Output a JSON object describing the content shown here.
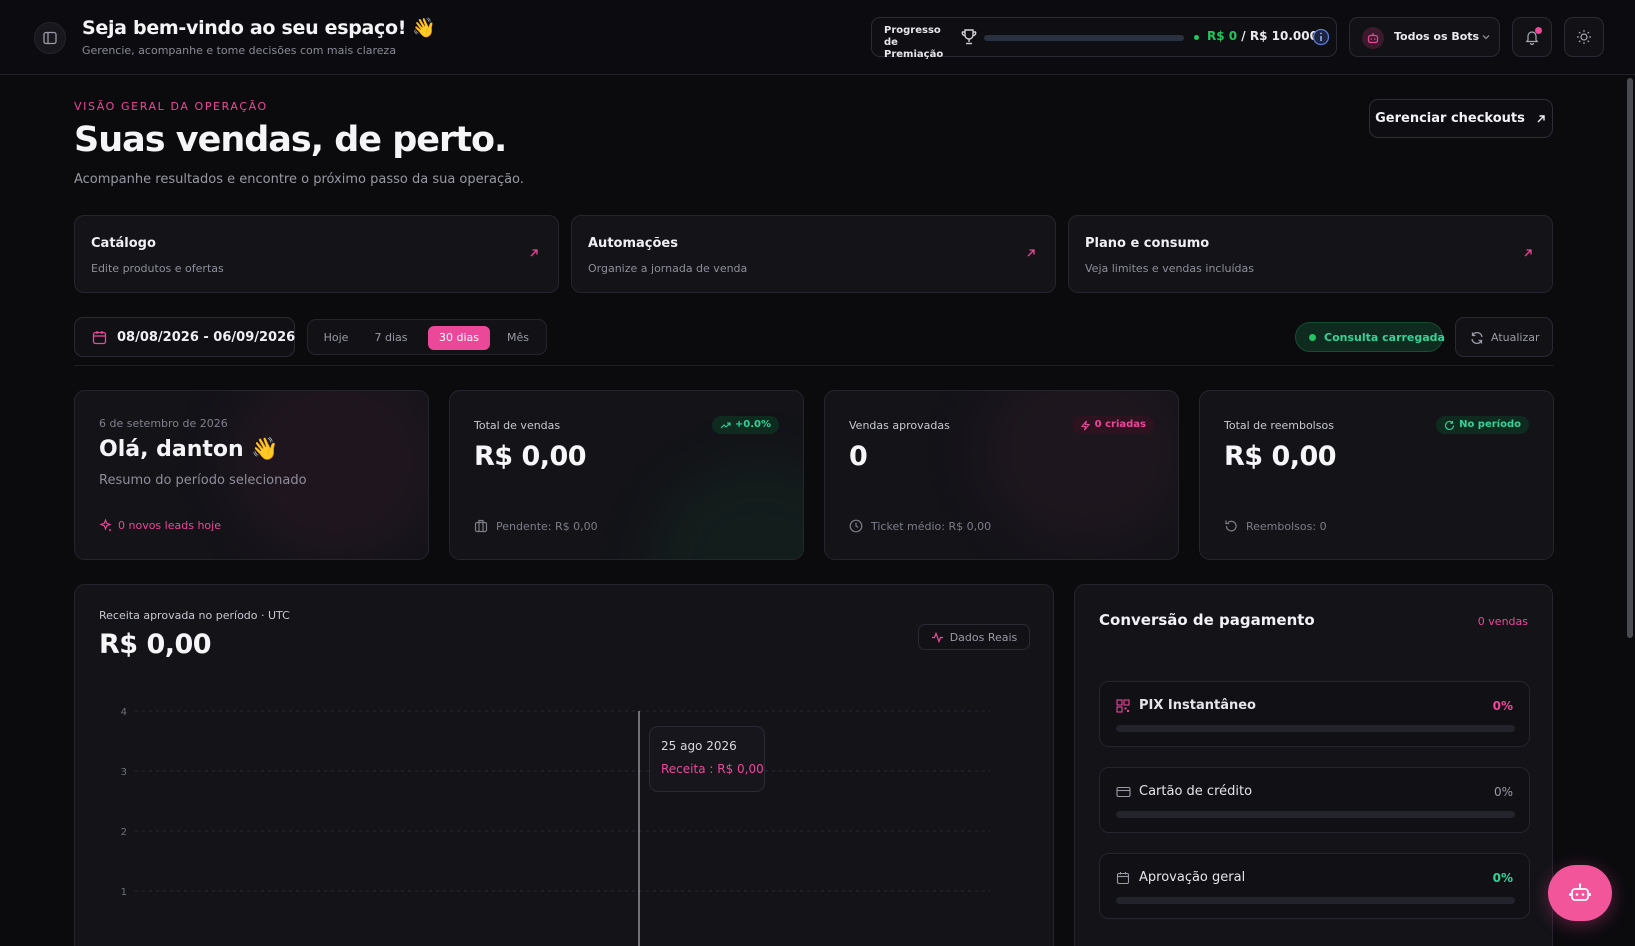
{
  "topbar": {
    "welcome_title": "Seja bem-vindo ao seu espaço! 👋",
    "welcome_subtitle": "Gerencie, acompanhe e tome decisões com mais clareza",
    "progress_label": "Progresso de Premiação",
    "progress_current": "R$ 0",
    "progress_total": " / R$ 10.000",
    "progress_fraction": 0,
    "bots_label": "Todos os Bots",
    "icons": [
      "sidebar-icon",
      "trophy-icon",
      "info-icon",
      "bot-icon",
      "chevron-down-icon",
      "bell-icon",
      "sun-icon"
    ]
  },
  "header": {
    "eyebrow": "VISÃO GERAL DA OPERAÇÃO",
    "title": "Suas vendas, de perto.",
    "subtitle": "Acompanhe resultados e encontre o próximo passo da sua operação.",
    "manage_button": "Gerenciar checkouts"
  },
  "quick_links": [
    {
      "title": "Catálogo",
      "subtitle": "Edite produtos e ofertas"
    },
    {
      "title": "Automações",
      "subtitle": "Organize a jornada de venda"
    },
    {
      "title": "Plano e consumo",
      "subtitle": "Veja limites e vendas incluídas"
    }
  ],
  "filters": {
    "date_range": "08/08/2026 - 06/09/2026",
    "ranges": [
      "Hoje",
      "7 dias",
      "30 dias",
      "Mês"
    ],
    "active_range": "30 dias",
    "status": "Consulta carregada",
    "refresh": "Atualizar"
  },
  "stats": {
    "greeting": {
      "date": "6 de setembro de 2026",
      "hello": "Olá, danton 👋",
      "summary": "Resumo do período selecionado",
      "leads": "0 novos leads hoje"
    },
    "cards": [
      {
        "label": "Total de vendas",
        "value": "R$ 0,00",
        "badge": "+0.0%",
        "footer": "Pendente: R$ 0,00"
      },
      {
        "label": "Vendas aprovadas",
        "value": "0",
        "badge": "0 criadas",
        "footer": "Ticket médio: R$ 0,00"
      },
      {
        "label": "Total de reembolsos",
        "value": "R$ 0,00",
        "badge": "No período",
        "footer": "Reembolsos: 0"
      }
    ]
  },
  "revenue_chart": {
    "label": "Receita aprovada no período · UTC",
    "value": "R$ 0,00",
    "real_data_button": "Dados Reais",
    "tooltip_date": "25 ago 2026",
    "tooltip_value": "Receita : R$ 0,00"
  },
  "chart_data": {
    "type": "line",
    "y_ticks": [
      4,
      3,
      2,
      1
    ],
    "ylim": [
      0,
      4
    ],
    "grid": true,
    "cursor_x": "25 ago 2026",
    "series": [
      {
        "values": []
      }
    ]
  },
  "conversion": {
    "title": "Conversão de pagamento",
    "count": "0 vendas",
    "methods": [
      {
        "name": "PIX Instantâneo",
        "percent": "0%",
        "fraction": 0,
        "color": "#ec4899"
      },
      {
        "name": "Cartão de crédito",
        "percent": "0%",
        "fraction": 0,
        "color": "#9a9aa5"
      },
      {
        "name": "Aprovação geral",
        "percent": "0%",
        "fraction": 0,
        "color": "#34d399"
      }
    ]
  },
  "colors": {
    "accent": "#ec4899",
    "success": "#22c55e",
    "background": "#0b0b0e",
    "card": "#131318"
  }
}
